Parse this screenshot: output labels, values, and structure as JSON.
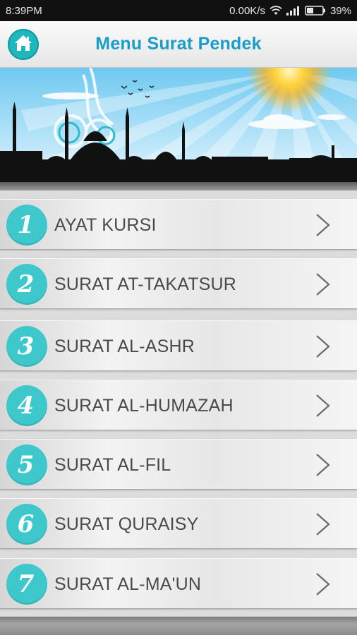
{
  "status_bar": {
    "time": "8:39PM",
    "network_speed": "0.00K/s",
    "battery_percent": "39%"
  },
  "header": {
    "title": "Menu Surat Pendek",
    "home_icon": "home-icon"
  },
  "colors": {
    "accent_teal": "#3ec8cc",
    "title_blue": "#1c9cc8"
  },
  "menu": {
    "items": [
      {
        "number": "1",
        "label": "AYAT KURSI"
      },
      {
        "number": "2",
        "label": "SURAT AT-TAKATSUR"
      },
      {
        "number": "3",
        "label": "SURAT AL-ASHR"
      },
      {
        "number": "4",
        "label": "SURAT AL-HUMAZAH"
      },
      {
        "number": "5",
        "label": "SURAT AL-FIL"
      },
      {
        "number": "6",
        "label": "SURAT QURAISY"
      },
      {
        "number": "7",
        "label": "SURAT AL-MA'UN"
      }
    ]
  }
}
